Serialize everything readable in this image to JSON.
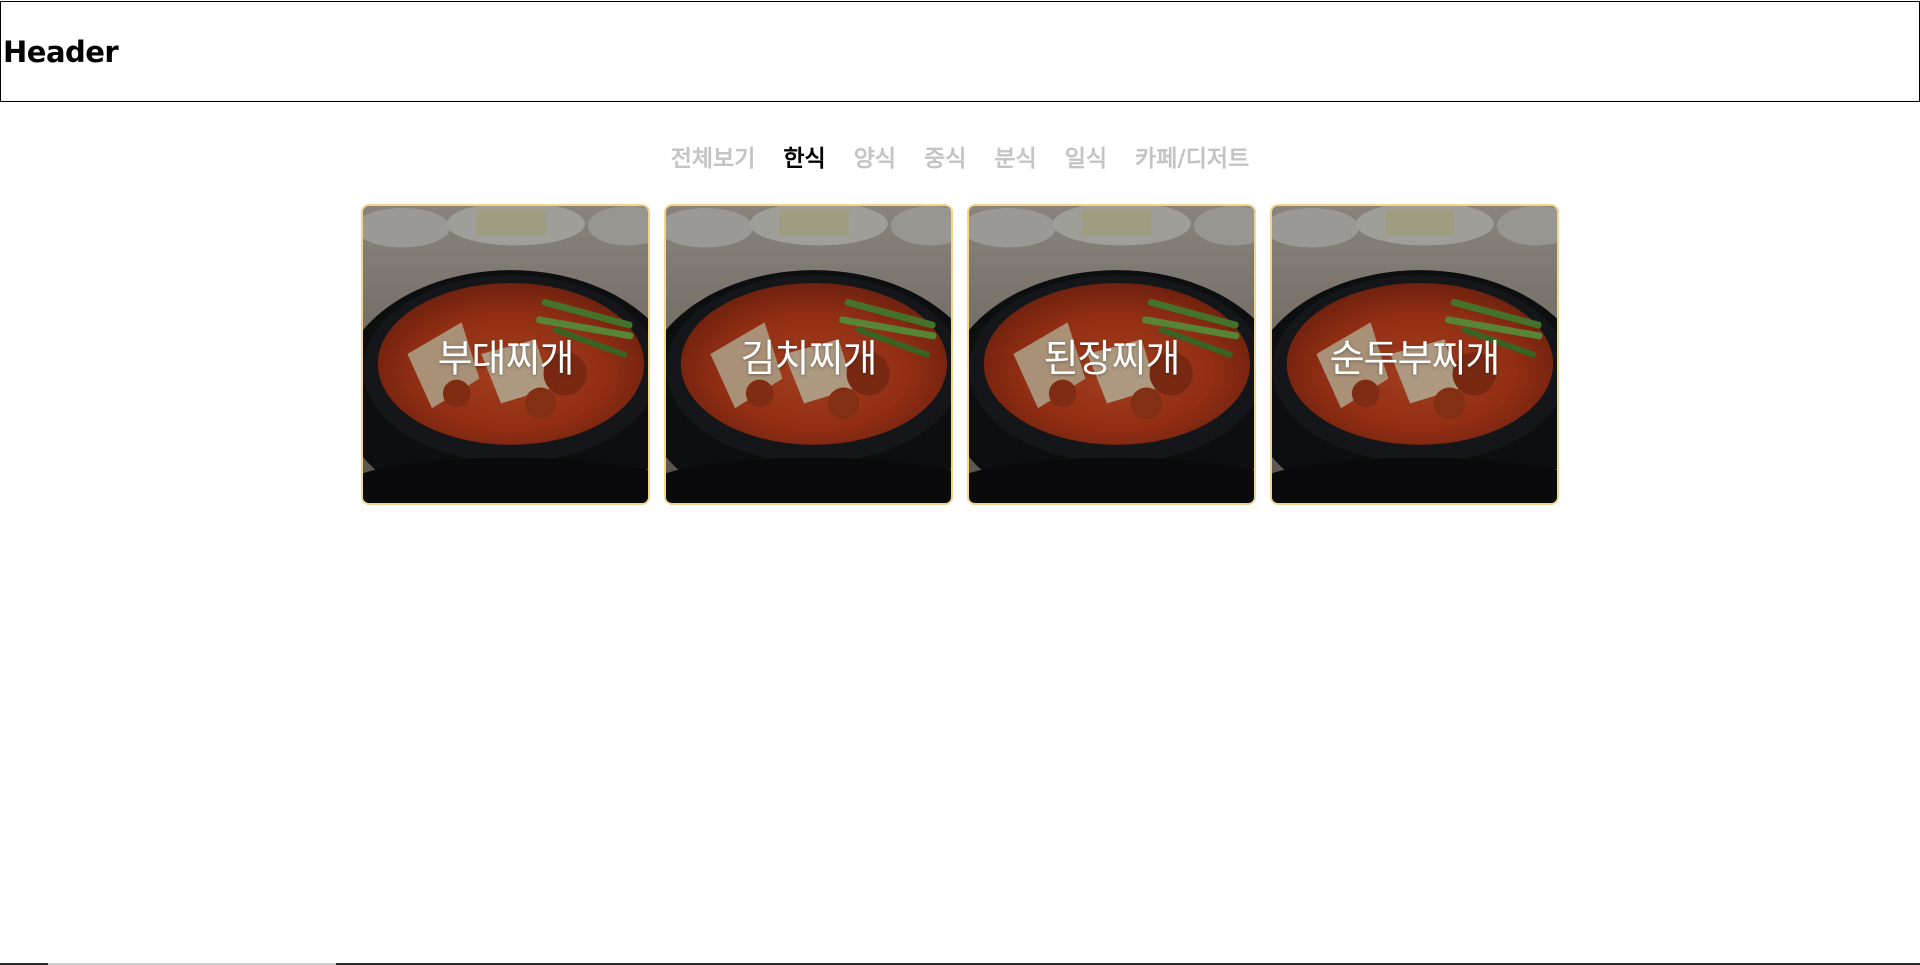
{
  "header": {
    "title": "Header"
  },
  "tabs": [
    {
      "label": "전체보기",
      "active": false
    },
    {
      "label": "한식",
      "active": true
    },
    {
      "label": "양식",
      "active": false
    },
    {
      "label": "중식",
      "active": false
    },
    {
      "label": "분식",
      "active": false
    },
    {
      "label": "일식",
      "active": false
    },
    {
      "label": "카페/디저트",
      "active": false
    }
  ],
  "cards": [
    {
      "name": "부대찌개",
      "image": "stew-photo"
    },
    {
      "name": "김치찌개",
      "image": "stew-photo"
    },
    {
      "name": "된장찌개",
      "image": "stew-photo"
    },
    {
      "name": "순두부찌개",
      "image": "stew-photo"
    }
  ],
  "colors": {
    "active_tab": "#000000",
    "inactive_tab": "#c4c4c4",
    "card_border": "#f2d68a",
    "card_label": "#ffffff"
  }
}
